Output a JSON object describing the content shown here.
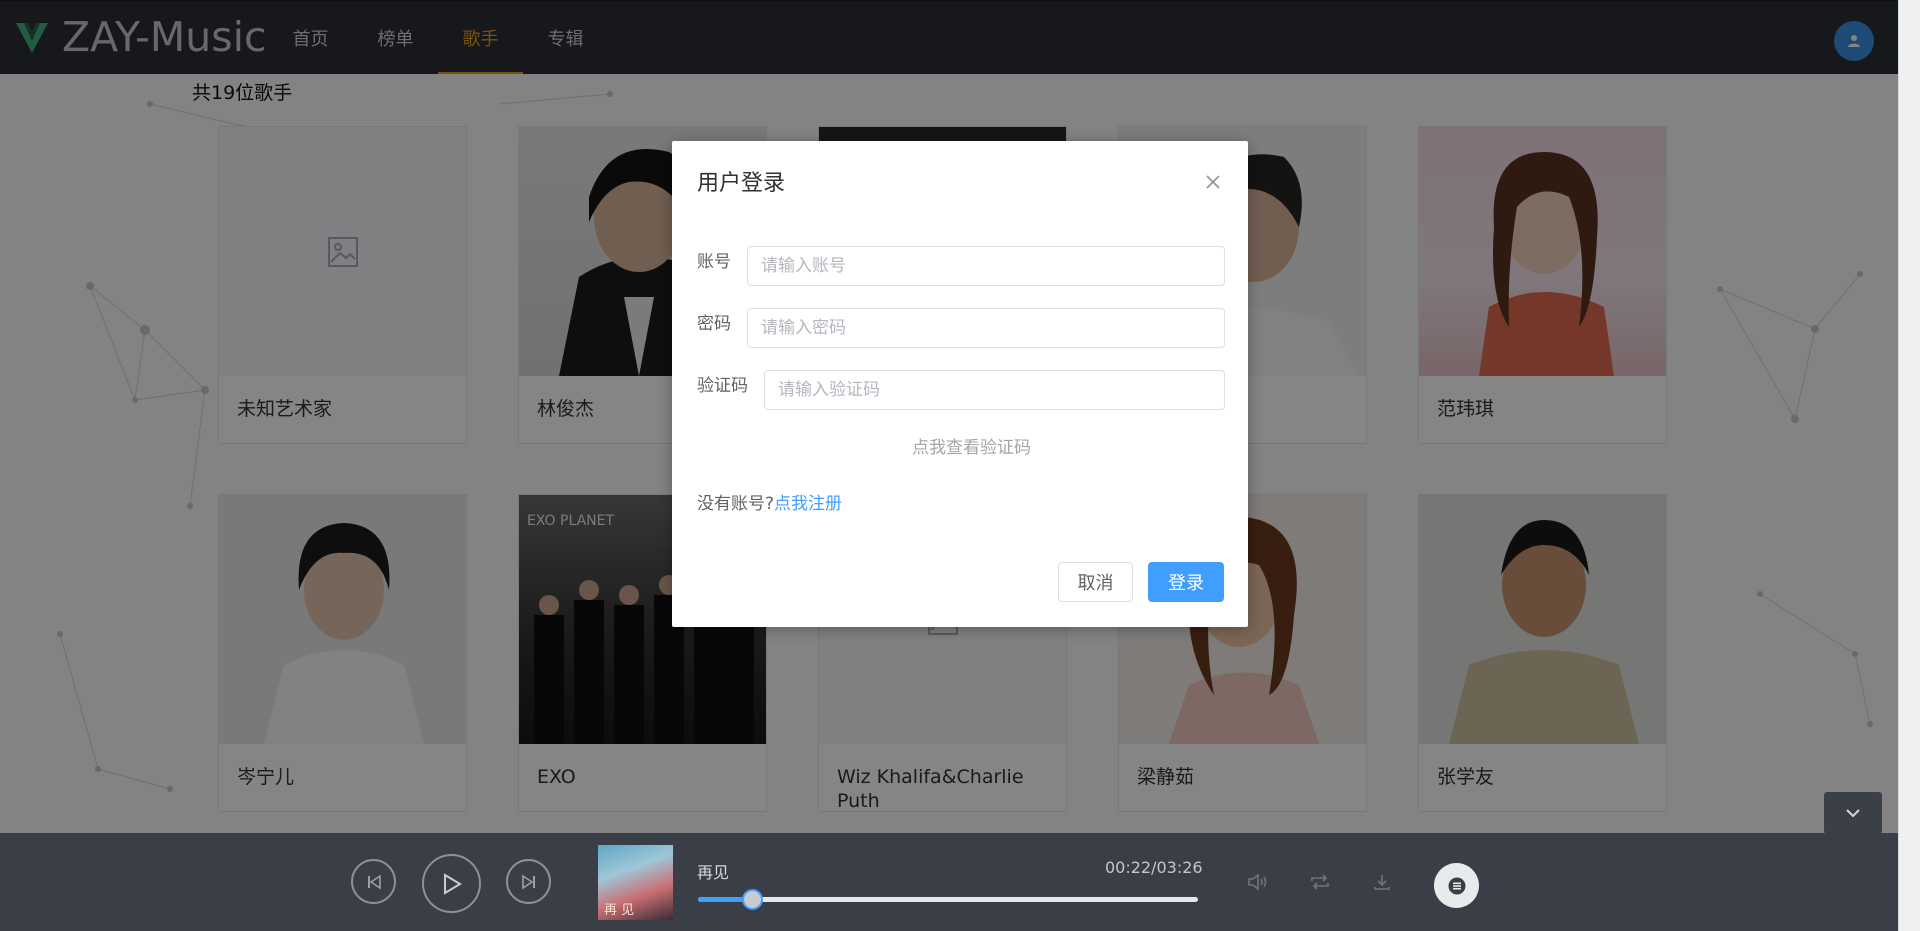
{
  "app": {
    "logo_text": "ZAY-Music"
  },
  "nav": {
    "items": [
      {
        "label": "首页"
      },
      {
        "label": "榜单"
      },
      {
        "label": "歌手",
        "active": true
      },
      {
        "label": "专辑"
      }
    ]
  },
  "singers": {
    "count_text": "共19位歌手",
    "cards": [
      {
        "name": "未知艺术家",
        "has_photo": false
      },
      {
        "name": "林俊杰",
        "has_photo": true
      },
      {
        "name": "",
        "has_photo": true
      },
      {
        "name": "",
        "has_photo": true
      },
      {
        "name": "范玮琪",
        "has_photo": true
      },
      {
        "name": "岑宁儿",
        "has_photo": true
      },
      {
        "name": "EXO",
        "has_photo": true
      },
      {
        "name": "Wiz Khalifa&Charlie Puth",
        "has_photo": false
      },
      {
        "name": "梁静茹",
        "has_photo": true
      },
      {
        "name": "张学友",
        "has_photo": true
      }
    ]
  },
  "login_modal": {
    "title": "用户登录",
    "account_label": "账号",
    "account_placeholder": "请输入账号",
    "password_label": "密码",
    "password_placeholder": "请输入密码",
    "captcha_label": "验证码",
    "captcha_placeholder": "请输入验证码",
    "captcha_link": "点我查看验证码",
    "no_account_text": "没有账号?",
    "register_link": "点我注册",
    "cancel_label": "取消",
    "login_label": "登录"
  },
  "player": {
    "song_title": "再见",
    "time": "00:22/03:26",
    "album_text": "再 见",
    "progress": 0.107
  },
  "colors": {
    "accent": "#e3a21a",
    "primary": "#409eff",
    "header_bg": "#2b2f36",
    "player_bg": "#3a3f47"
  },
  "icons": {
    "logo": "v-logo-icon",
    "user": "user-icon",
    "placeholder": "image-placeholder-icon",
    "close": "close-icon",
    "prev": "skip-previous-icon",
    "play": "play-icon",
    "next": "skip-next-icon",
    "volume": "volume-icon",
    "loop": "loop-icon",
    "download": "download-icon",
    "playlist": "playlist-icon",
    "scroll": "chevron-down-icon"
  }
}
